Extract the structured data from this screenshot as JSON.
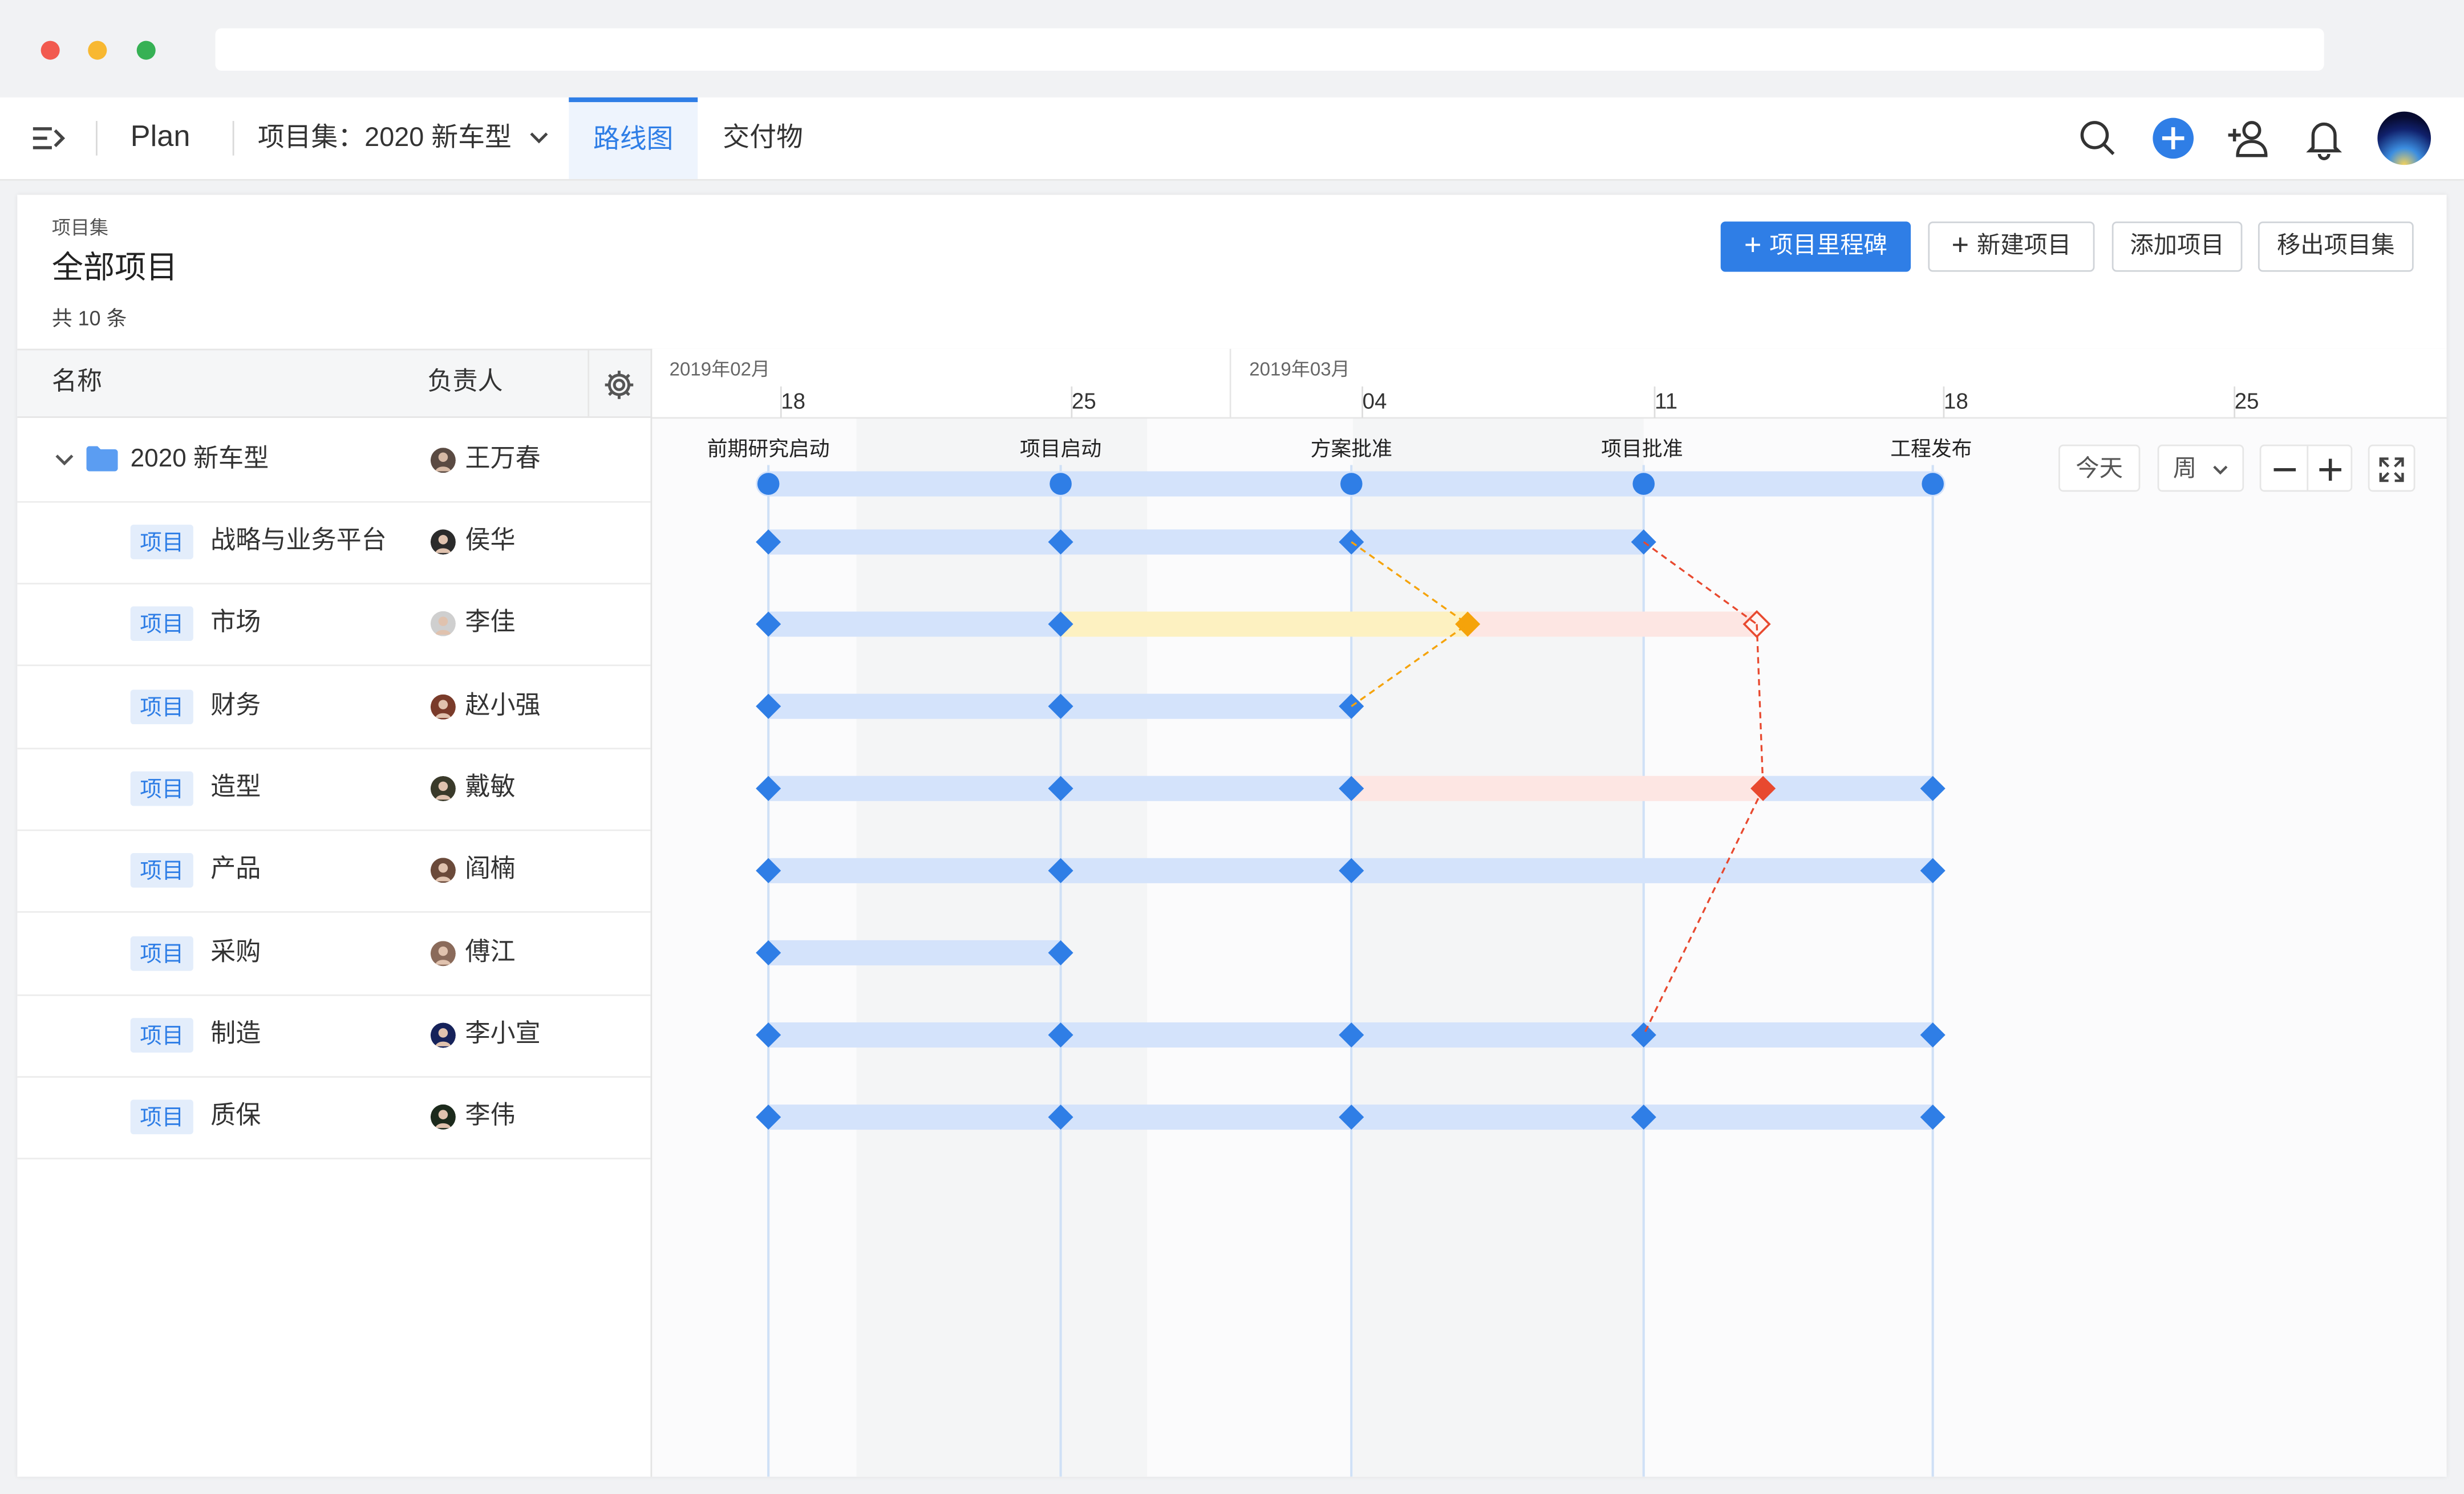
{
  "header": {
    "app_name": "Plan",
    "project_set": "项目集：2020 新车型",
    "tabs": [
      {
        "label": "路线图",
        "active": true
      },
      {
        "label": "交付物",
        "active": false
      }
    ]
  },
  "panel": {
    "eyebrow": "项目集",
    "title": "全部项目",
    "count": "共 10 条",
    "buttons": {
      "milestone": "项目里程碑",
      "new_project": "新建项目",
      "add_project": "添加项目",
      "remove_set": "移出项目集"
    }
  },
  "table": {
    "col_name": "名称",
    "col_owner": "负责人",
    "group": {
      "name": "2020 新车型",
      "owner": "王万春"
    },
    "tag": "项目",
    "rows": [
      {
        "name": "战略与业务平台",
        "owner": "侯华"
      },
      {
        "name": "市场",
        "owner": "李佳"
      },
      {
        "name": "财务",
        "owner": "赵小强"
      },
      {
        "name": "造型",
        "owner": "戴敏"
      },
      {
        "name": "产品",
        "owner": "阎楠"
      },
      {
        "name": "采购",
        "owner": "傅江"
      },
      {
        "name": "制造",
        "owner": "李小宣"
      },
      {
        "name": "质保",
        "owner": "李伟"
      }
    ]
  },
  "timeline": {
    "months": [
      "2019年02月",
      "2019年03月"
    ],
    "days": [
      "18",
      "25",
      "04",
      "11",
      "18",
      "25"
    ],
    "milestones": [
      "前期研究启动",
      "项目启动",
      "方案批准",
      "项目批准",
      "工程发布"
    ],
    "controls": {
      "today": "今天",
      "scale": "周"
    }
  },
  "colors": {
    "accent": "#2f7ee6",
    "bar": "#d4e3fb",
    "warn_bar": "#fdf1c1",
    "risk_bar": "#fde6e3",
    "warn": "#f5a30a",
    "danger": "#e8492f"
  }
}
